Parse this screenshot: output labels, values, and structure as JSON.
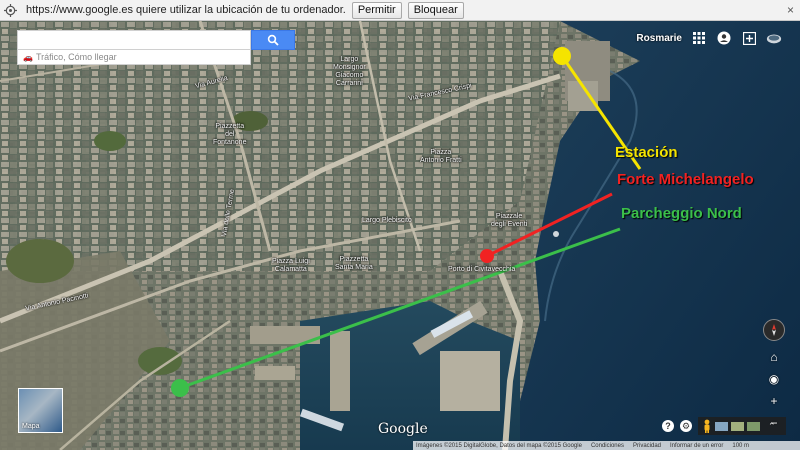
{
  "permission_bar": {
    "message": "https://www.google.es quiere utilizar la ubicación de tu ordenador.",
    "allow_label": "Permitir",
    "block_label": "Bloquear",
    "close_label": "×"
  },
  "search": {
    "value": "",
    "sub_label": "Tráfico, Cómo llegar"
  },
  "header": {
    "account_label": "Rosmarie"
  },
  "annotations": {
    "estacion": "Estación",
    "forte": "Forte Michelangelo",
    "parcheggio": "Parcheggio Nord"
  },
  "map_labels": {
    "vf_crispi": "Via Francesco Crispi",
    "largo_monsignor": "Largo\nMonsignor\nGiacomo\nCarrarini",
    "piazza_fontanone": "Piazzetta\ndel\nFontanone",
    "piazza_ant_fratti": "Piazza\nAntonio Fratti",
    "piazzale_vinete": "Piazzale\ndegli Eventi",
    "largo_plebiscito": "Largo Plebiscito",
    "piazza_luigi": "Piazza Luigi\nCalamatta",
    "piazza_santa_maria": "Piazzetta\nSanta Maria",
    "porto": "Porto di Civitavecchia",
    "via_antonio_pacinotti": "Via Antonio Pacinotti",
    "via_terme": "Via delle Terme",
    "via_aurelia": "Via Aurelia"
  },
  "thumbnail": {
    "label": "Mapa"
  },
  "logo": "Google",
  "attribution": {
    "imagery": "Imágenes ©2015 DigitalGlobe, Datos del mapa ©2015 Google",
    "terms": "Condiciones",
    "privacy": "Privacidad",
    "report": "Informar de un error",
    "scale": "100 m"
  },
  "help": {
    "question": "?",
    "settings": "⚙"
  },
  "colors": {
    "estacion": "#f5e400",
    "forte": "#f12222",
    "parcheggio": "#3bbf4a",
    "search_button": "#4a8af4"
  }
}
